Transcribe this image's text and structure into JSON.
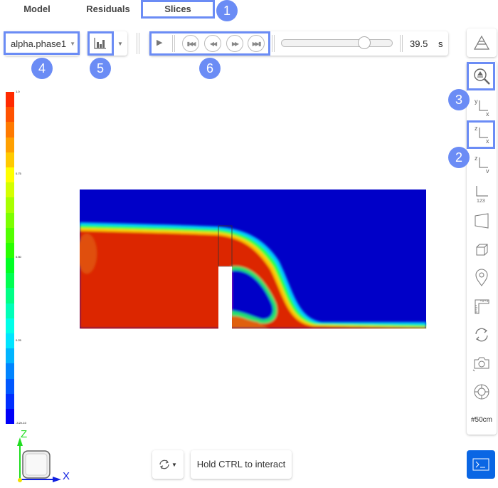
{
  "tabs": [
    {
      "label": "Model"
    },
    {
      "label": "Residuals"
    },
    {
      "label": "Slices",
      "active": true
    }
  ],
  "annotations": [
    "1",
    "2",
    "3",
    "4",
    "5",
    "6"
  ],
  "toolbar": {
    "field_select": {
      "value": "alpha.phase1"
    },
    "time_value": "39.5",
    "time_unit": "s",
    "slider_fraction": 0.77
  },
  "colorbar": {
    "labels": [
      "1.0",
      "0.75",
      "0.50",
      "0.25",
      "-3.2e-10"
    ],
    "colors": [
      "#ff2a00",
      "#ff5200",
      "#ff7a00",
      "#ffa000",
      "#ffca00",
      "#ffff00",
      "#d4ff00",
      "#a8ff00",
      "#7cff00",
      "#52ff00",
      "#28ff00",
      "#00ff24",
      "#00ff52",
      "#00ff86",
      "#00ffb8",
      "#00ffe8",
      "#00e4ff",
      "#00b4ff",
      "#0084ff",
      "#0058ff",
      "#002eff",
      "#0000f8"
    ]
  },
  "view_tools": [
    {
      "name": "layers-icon"
    },
    {
      "name": "zoom-fit-icon"
    },
    {
      "name": "view-xy-icon",
      "top": "y",
      "bottom": "x"
    },
    {
      "name": "view-xz-icon",
      "top": "z",
      "bottom": "x"
    },
    {
      "name": "view-yz-icon",
      "top": "z",
      "bottom": "y"
    },
    {
      "name": "axis-numbers-icon",
      "text": "123"
    },
    {
      "name": "perspective-icon"
    },
    {
      "name": "cube-icon"
    },
    {
      "name": "location-pin-icon"
    },
    {
      "name": "ruler-icon"
    },
    {
      "name": "rotate-icon"
    },
    {
      "name": "camera-icon"
    },
    {
      "name": "lifebuoy-icon"
    },
    {
      "name": "grid-scale",
      "text": "#50cm"
    }
  ],
  "axes_triad": {
    "z_label": "Z",
    "x_label": "X"
  },
  "bottom": {
    "interact_label": "Hold CTRL to interact"
  },
  "colors": {
    "accent": "#6b8cf5",
    "terminal": "#0a66e4",
    "water": "#dc2800",
    "air": "#0000c8"
  }
}
